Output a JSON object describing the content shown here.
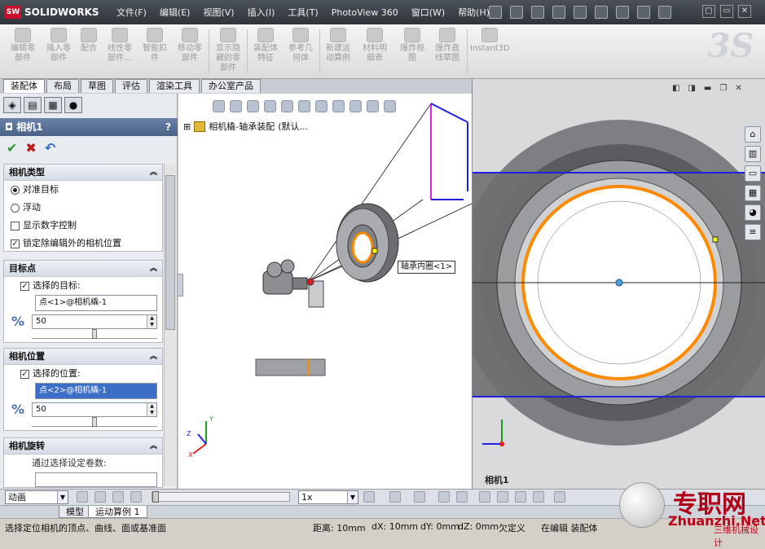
{
  "app": {
    "brand": "SOLIDWORKS",
    "brand_badge": "SW"
  },
  "menu": [
    "文件(F)",
    "编辑(E)",
    "视图(V)",
    "插入(I)",
    "工具(T)",
    "PhotoView 360",
    "窗口(W)",
    "帮助(H)"
  ],
  "window_buttons": [
    "▢",
    "▭",
    "✕"
  ],
  "commands": [
    {
      "label": "编辑零\n部件",
      "icon": "edit-component-icon"
    },
    {
      "label": "插入零\n部件",
      "icon": "insert-component-icon"
    },
    {
      "label": "配合",
      "icon": "mate-icon"
    },
    {
      "label": "线性零\n部件…",
      "icon": "linear-pattern-icon"
    },
    {
      "label": "智能扣\n件",
      "icon": "smart-fastener-icon"
    },
    {
      "label": "移动零\n部件",
      "icon": "move-component-icon"
    },
    {
      "label": "显示隐\n藏的零\n部件",
      "icon": "show-hidden-icon"
    },
    {
      "label": "装配体\n特征",
      "icon": "assembly-feature-icon"
    },
    {
      "label": "参考几\n何体",
      "icon": "reference-geometry-icon"
    },
    {
      "label": "新建运\n动算例",
      "icon": "new-motion-study-icon"
    },
    {
      "label": "材料明\n细表",
      "icon": "bom-icon"
    },
    {
      "label": "爆炸视\n图",
      "icon": "exploded-view-icon"
    },
    {
      "label": "爆炸直\n线草图",
      "icon": "explode-line-sketch-icon"
    },
    {
      "label": "Instant3D",
      "icon": "instant3d-icon"
    }
  ],
  "tabs": [
    "装配体",
    "布局",
    "草图",
    "评估",
    "渲染工具",
    "办公室产品"
  ],
  "property": {
    "title": "相机1",
    "help": "?",
    "ok": "✔",
    "cancel": "✖",
    "undo": "↶",
    "camera_type": {
      "header": "相机类型",
      "opt_target": "对准目标",
      "opt_float": "浮动",
      "show_numeric": "显示数字控制",
      "lock_position": "锁定除编辑外的相机位置"
    },
    "target": {
      "header": "目标点",
      "checkbox": "选择的目标:",
      "value": "点<1>@相机橇-1",
      "spin": "50",
      "spin_fraction": 0.5
    },
    "position": {
      "header": "相机位置",
      "checkbox": "选择的位置:",
      "value": "点<2>@相机橇-1",
      "spin": "50",
      "spin_fraction": 0.5
    },
    "rotation": {
      "header": "相机旋转",
      "label": "通过选择设定卷数:",
      "value": ""
    }
  },
  "tree": {
    "label": "相机橇-轴承装配",
    "config": "(默认..."
  },
  "tooltip": "轴承内圈<1>",
  "camera_view": {
    "label": "相机1"
  },
  "animation": {
    "mode": "动画",
    "speed": "1x",
    "timeline_fraction": 0.0
  },
  "bottom_tabs": [
    "模型",
    "运动算例 1"
  ],
  "status": {
    "hint": "选择定位相机的顶点、曲线、面或基准面",
    "distance": "距离: 10mm",
    "dx": "dX: 10mm",
    "dy": "dY: 0mm",
    "dz": "dZ: 0mm",
    "state": "欠定义",
    "editing": "在编辑 装配体"
  },
  "watermark": {
    "cn": "专职网",
    "en": "Zhuanzhi.Net",
    "sub": "三维机械设计"
  },
  "colors": {
    "accent_orange": "#ff8a00",
    "blue_line": "#2020e0",
    "magenta_line": "#e020e0"
  }
}
